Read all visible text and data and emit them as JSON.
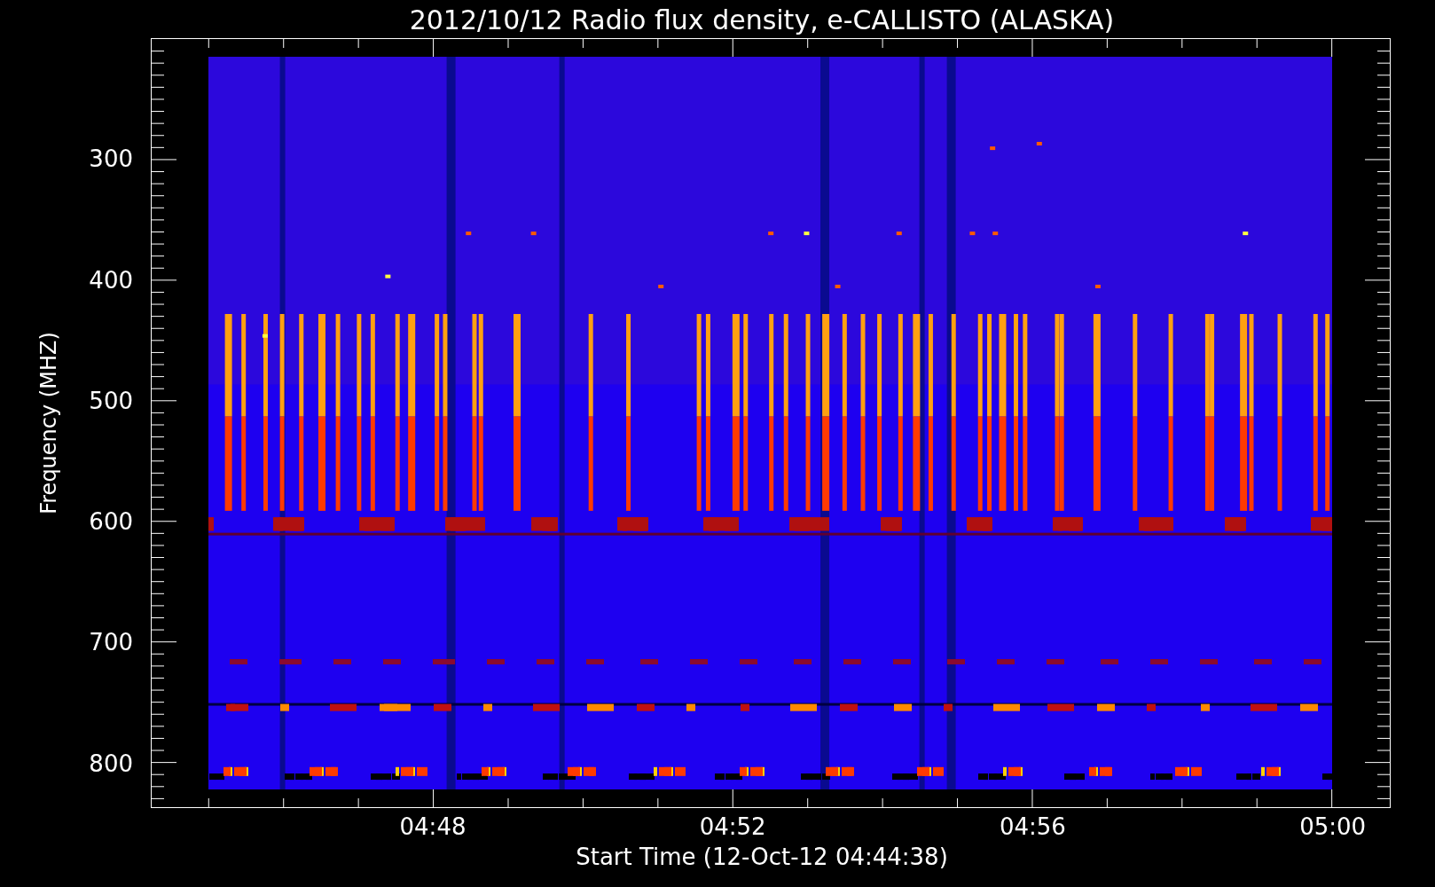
{
  "title": "2012/10/12  Radio flux density, e-CALLISTO (ALASKA)",
  "y_axis": {
    "title": "Frequency (MHZ)",
    "ticks": [
      "300",
      "400",
      "500",
      "600",
      "700",
      "800"
    ]
  },
  "x_axis": {
    "title": "Start Time (12-Oct-12 04:44:38)",
    "ticks": [
      "04:48",
      "04:52",
      "04:56",
      "05:00"
    ]
  }
}
